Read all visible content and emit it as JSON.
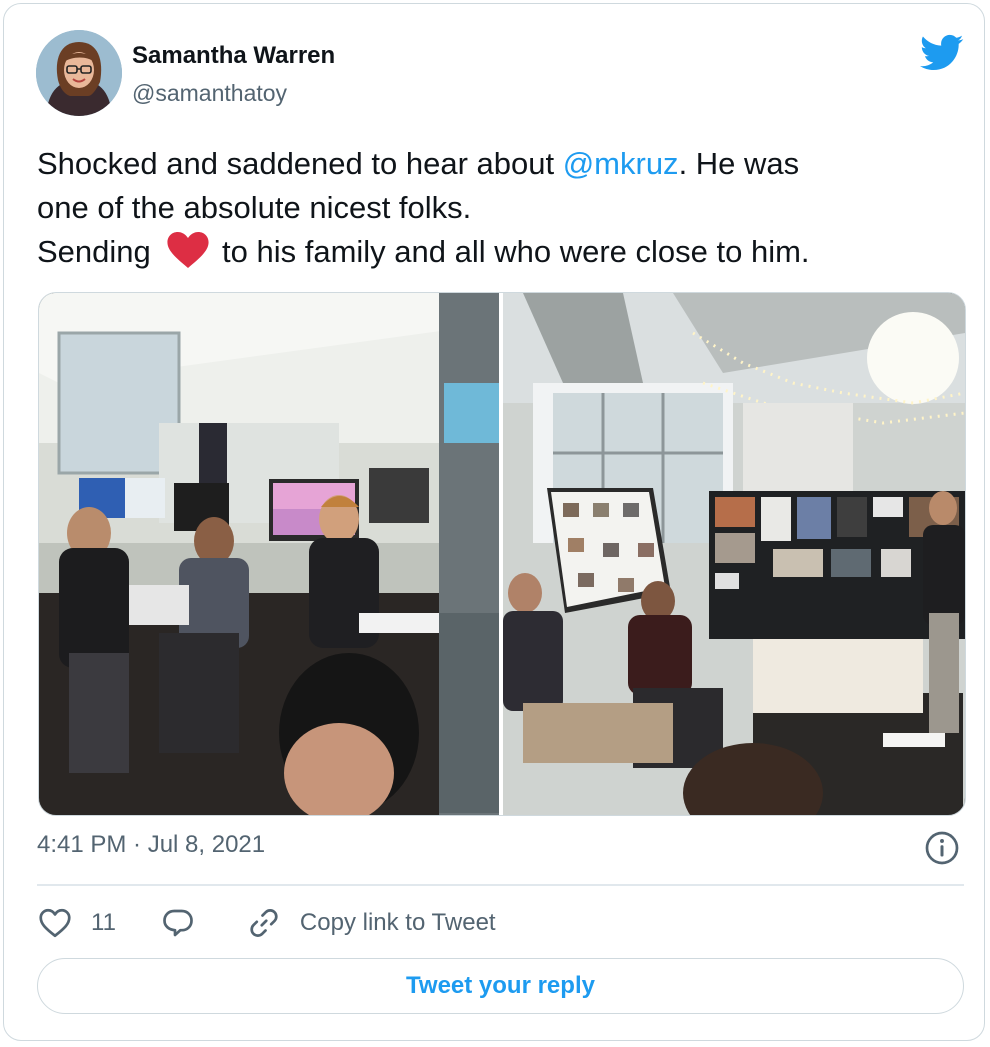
{
  "author": {
    "name": "Samantha Warren",
    "handle": "@samanthatoy"
  },
  "tweet": {
    "line1_before": "Shocked and saddened to hear about ",
    "mention": "@mkruz",
    "line1_after": ". He was",
    "line2": "one of the absolute nicest folks.",
    "line3_before": "Sending ",
    "line3_after": " to his family and all who were close to him."
  },
  "meta": {
    "timestamp": "4:41 PM · Jul 8, 2021"
  },
  "actions": {
    "like_count": "11",
    "copy_link_label": "Copy link to Tweet"
  },
  "reply": {
    "label": "Tweet your reply"
  },
  "icons": {
    "brand": "twitter-bird-icon",
    "heart_emoji": "red-heart-icon",
    "like": "heart-outline-icon",
    "reply": "speech-bubble-icon",
    "link": "link-icon",
    "info": "info-icon"
  },
  "colors": {
    "brand_blue": "#1d9bf0",
    "text_primary": "#0f1419",
    "text_secondary": "#536471",
    "heart_red": "#e0245e",
    "border": "#cfd9de"
  }
}
